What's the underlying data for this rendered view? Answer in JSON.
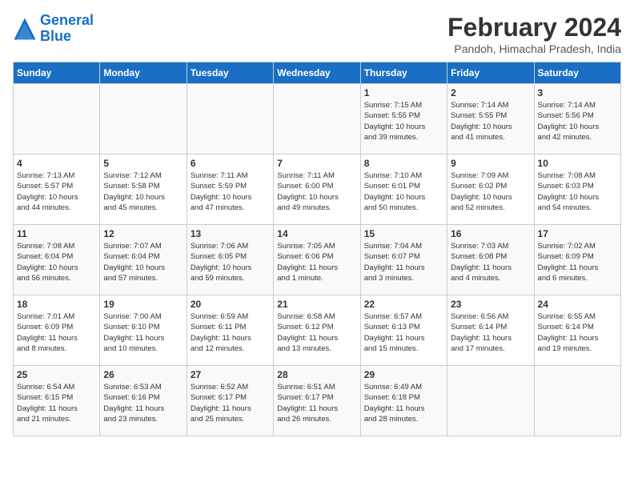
{
  "header": {
    "logo_line1": "General",
    "logo_line2": "Blue",
    "month_title": "February 2024",
    "location": "Pandoh, Himachal Pradesh, India"
  },
  "days_of_week": [
    "Sunday",
    "Monday",
    "Tuesday",
    "Wednesday",
    "Thursday",
    "Friday",
    "Saturday"
  ],
  "weeks": [
    [
      {
        "day": "",
        "info": ""
      },
      {
        "day": "",
        "info": ""
      },
      {
        "day": "",
        "info": ""
      },
      {
        "day": "",
        "info": ""
      },
      {
        "day": "1",
        "info": "Sunrise: 7:15 AM\nSunset: 5:55 PM\nDaylight: 10 hours\nand 39 minutes."
      },
      {
        "day": "2",
        "info": "Sunrise: 7:14 AM\nSunset: 5:55 PM\nDaylight: 10 hours\nand 41 minutes."
      },
      {
        "day": "3",
        "info": "Sunrise: 7:14 AM\nSunset: 5:56 PM\nDaylight: 10 hours\nand 42 minutes."
      }
    ],
    [
      {
        "day": "4",
        "info": "Sunrise: 7:13 AM\nSunset: 5:57 PM\nDaylight: 10 hours\nand 44 minutes."
      },
      {
        "day": "5",
        "info": "Sunrise: 7:12 AM\nSunset: 5:58 PM\nDaylight: 10 hours\nand 45 minutes."
      },
      {
        "day": "6",
        "info": "Sunrise: 7:11 AM\nSunset: 5:59 PM\nDaylight: 10 hours\nand 47 minutes."
      },
      {
        "day": "7",
        "info": "Sunrise: 7:11 AM\nSunset: 6:00 PM\nDaylight: 10 hours\nand 49 minutes."
      },
      {
        "day": "8",
        "info": "Sunrise: 7:10 AM\nSunset: 6:01 PM\nDaylight: 10 hours\nand 50 minutes."
      },
      {
        "day": "9",
        "info": "Sunrise: 7:09 AM\nSunset: 6:02 PM\nDaylight: 10 hours\nand 52 minutes."
      },
      {
        "day": "10",
        "info": "Sunrise: 7:08 AM\nSunset: 6:03 PM\nDaylight: 10 hours\nand 54 minutes."
      }
    ],
    [
      {
        "day": "11",
        "info": "Sunrise: 7:08 AM\nSunset: 6:04 PM\nDaylight: 10 hours\nand 56 minutes."
      },
      {
        "day": "12",
        "info": "Sunrise: 7:07 AM\nSunset: 6:04 PM\nDaylight: 10 hours\nand 57 minutes."
      },
      {
        "day": "13",
        "info": "Sunrise: 7:06 AM\nSunset: 6:05 PM\nDaylight: 10 hours\nand 59 minutes."
      },
      {
        "day": "14",
        "info": "Sunrise: 7:05 AM\nSunset: 6:06 PM\nDaylight: 11 hours\nand 1 minute."
      },
      {
        "day": "15",
        "info": "Sunrise: 7:04 AM\nSunset: 6:07 PM\nDaylight: 11 hours\nand 3 minutes."
      },
      {
        "day": "16",
        "info": "Sunrise: 7:03 AM\nSunset: 6:08 PM\nDaylight: 11 hours\nand 4 minutes."
      },
      {
        "day": "17",
        "info": "Sunrise: 7:02 AM\nSunset: 6:09 PM\nDaylight: 11 hours\nand 6 minutes."
      }
    ],
    [
      {
        "day": "18",
        "info": "Sunrise: 7:01 AM\nSunset: 6:09 PM\nDaylight: 11 hours\nand 8 minutes."
      },
      {
        "day": "19",
        "info": "Sunrise: 7:00 AM\nSunset: 6:10 PM\nDaylight: 11 hours\nand 10 minutes."
      },
      {
        "day": "20",
        "info": "Sunrise: 6:59 AM\nSunset: 6:11 PM\nDaylight: 11 hours\nand 12 minutes."
      },
      {
        "day": "21",
        "info": "Sunrise: 6:58 AM\nSunset: 6:12 PM\nDaylight: 11 hours\nand 13 minutes."
      },
      {
        "day": "22",
        "info": "Sunrise: 6:57 AM\nSunset: 6:13 PM\nDaylight: 11 hours\nand 15 minutes."
      },
      {
        "day": "23",
        "info": "Sunrise: 6:56 AM\nSunset: 6:14 PM\nDaylight: 11 hours\nand 17 minutes."
      },
      {
        "day": "24",
        "info": "Sunrise: 6:55 AM\nSunset: 6:14 PM\nDaylight: 11 hours\nand 19 minutes."
      }
    ],
    [
      {
        "day": "25",
        "info": "Sunrise: 6:54 AM\nSunset: 6:15 PM\nDaylight: 11 hours\nand 21 minutes."
      },
      {
        "day": "26",
        "info": "Sunrise: 6:53 AM\nSunset: 6:16 PM\nDaylight: 11 hours\nand 23 minutes."
      },
      {
        "day": "27",
        "info": "Sunrise: 6:52 AM\nSunset: 6:17 PM\nDaylight: 11 hours\nand 25 minutes."
      },
      {
        "day": "28",
        "info": "Sunrise: 6:51 AM\nSunset: 6:17 PM\nDaylight: 11 hours\nand 26 minutes."
      },
      {
        "day": "29",
        "info": "Sunrise: 6:49 AM\nSunset: 6:18 PM\nDaylight: 11 hours\nand 28 minutes."
      },
      {
        "day": "",
        "info": ""
      },
      {
        "day": "",
        "info": ""
      }
    ]
  ]
}
